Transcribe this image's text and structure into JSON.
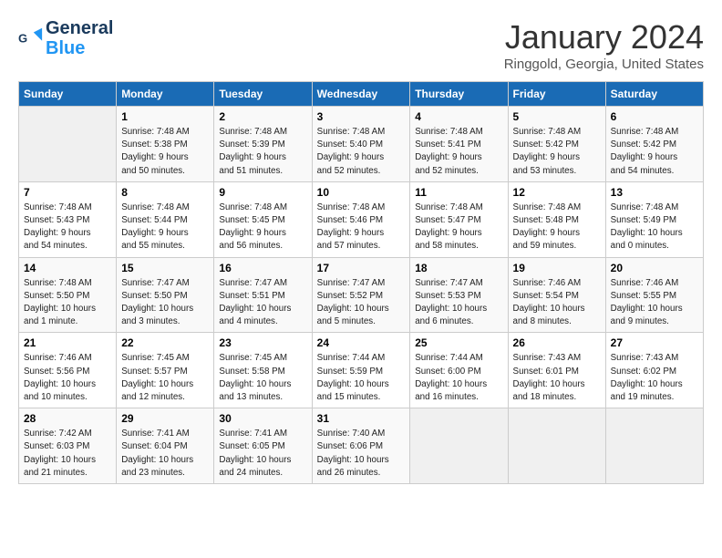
{
  "logo": {
    "text_general": "General",
    "text_blue": "Blue"
  },
  "header": {
    "month": "January 2024",
    "location": "Ringgold, Georgia, United States"
  },
  "days_of_week": [
    "Sunday",
    "Monday",
    "Tuesday",
    "Wednesday",
    "Thursday",
    "Friday",
    "Saturday"
  ],
  "weeks": [
    [
      {
        "day": "",
        "info": ""
      },
      {
        "day": "1",
        "info": "Sunrise: 7:48 AM\nSunset: 5:38 PM\nDaylight: 9 hours\nand 50 minutes."
      },
      {
        "day": "2",
        "info": "Sunrise: 7:48 AM\nSunset: 5:39 PM\nDaylight: 9 hours\nand 51 minutes."
      },
      {
        "day": "3",
        "info": "Sunrise: 7:48 AM\nSunset: 5:40 PM\nDaylight: 9 hours\nand 52 minutes."
      },
      {
        "day": "4",
        "info": "Sunrise: 7:48 AM\nSunset: 5:41 PM\nDaylight: 9 hours\nand 52 minutes."
      },
      {
        "day": "5",
        "info": "Sunrise: 7:48 AM\nSunset: 5:42 PM\nDaylight: 9 hours\nand 53 minutes."
      },
      {
        "day": "6",
        "info": "Sunrise: 7:48 AM\nSunset: 5:42 PM\nDaylight: 9 hours\nand 54 minutes."
      }
    ],
    [
      {
        "day": "7",
        "info": "Sunrise: 7:48 AM\nSunset: 5:43 PM\nDaylight: 9 hours\nand 54 minutes."
      },
      {
        "day": "8",
        "info": "Sunrise: 7:48 AM\nSunset: 5:44 PM\nDaylight: 9 hours\nand 55 minutes."
      },
      {
        "day": "9",
        "info": "Sunrise: 7:48 AM\nSunset: 5:45 PM\nDaylight: 9 hours\nand 56 minutes."
      },
      {
        "day": "10",
        "info": "Sunrise: 7:48 AM\nSunset: 5:46 PM\nDaylight: 9 hours\nand 57 minutes."
      },
      {
        "day": "11",
        "info": "Sunrise: 7:48 AM\nSunset: 5:47 PM\nDaylight: 9 hours\nand 58 minutes."
      },
      {
        "day": "12",
        "info": "Sunrise: 7:48 AM\nSunset: 5:48 PM\nDaylight: 9 hours\nand 59 minutes."
      },
      {
        "day": "13",
        "info": "Sunrise: 7:48 AM\nSunset: 5:49 PM\nDaylight: 10 hours\nand 0 minutes."
      }
    ],
    [
      {
        "day": "14",
        "info": "Sunrise: 7:48 AM\nSunset: 5:50 PM\nDaylight: 10 hours\nand 1 minute."
      },
      {
        "day": "15",
        "info": "Sunrise: 7:47 AM\nSunset: 5:50 PM\nDaylight: 10 hours\nand 3 minutes."
      },
      {
        "day": "16",
        "info": "Sunrise: 7:47 AM\nSunset: 5:51 PM\nDaylight: 10 hours\nand 4 minutes."
      },
      {
        "day": "17",
        "info": "Sunrise: 7:47 AM\nSunset: 5:52 PM\nDaylight: 10 hours\nand 5 minutes."
      },
      {
        "day": "18",
        "info": "Sunrise: 7:47 AM\nSunset: 5:53 PM\nDaylight: 10 hours\nand 6 minutes."
      },
      {
        "day": "19",
        "info": "Sunrise: 7:46 AM\nSunset: 5:54 PM\nDaylight: 10 hours\nand 8 minutes."
      },
      {
        "day": "20",
        "info": "Sunrise: 7:46 AM\nSunset: 5:55 PM\nDaylight: 10 hours\nand 9 minutes."
      }
    ],
    [
      {
        "day": "21",
        "info": "Sunrise: 7:46 AM\nSunset: 5:56 PM\nDaylight: 10 hours\nand 10 minutes."
      },
      {
        "day": "22",
        "info": "Sunrise: 7:45 AM\nSunset: 5:57 PM\nDaylight: 10 hours\nand 12 minutes."
      },
      {
        "day": "23",
        "info": "Sunrise: 7:45 AM\nSunset: 5:58 PM\nDaylight: 10 hours\nand 13 minutes."
      },
      {
        "day": "24",
        "info": "Sunrise: 7:44 AM\nSunset: 5:59 PM\nDaylight: 10 hours\nand 15 minutes."
      },
      {
        "day": "25",
        "info": "Sunrise: 7:44 AM\nSunset: 6:00 PM\nDaylight: 10 hours\nand 16 minutes."
      },
      {
        "day": "26",
        "info": "Sunrise: 7:43 AM\nSunset: 6:01 PM\nDaylight: 10 hours\nand 18 minutes."
      },
      {
        "day": "27",
        "info": "Sunrise: 7:43 AM\nSunset: 6:02 PM\nDaylight: 10 hours\nand 19 minutes."
      }
    ],
    [
      {
        "day": "28",
        "info": "Sunrise: 7:42 AM\nSunset: 6:03 PM\nDaylight: 10 hours\nand 21 minutes."
      },
      {
        "day": "29",
        "info": "Sunrise: 7:41 AM\nSunset: 6:04 PM\nDaylight: 10 hours\nand 23 minutes."
      },
      {
        "day": "30",
        "info": "Sunrise: 7:41 AM\nSunset: 6:05 PM\nDaylight: 10 hours\nand 24 minutes."
      },
      {
        "day": "31",
        "info": "Sunrise: 7:40 AM\nSunset: 6:06 PM\nDaylight: 10 hours\nand 26 minutes."
      },
      {
        "day": "",
        "info": ""
      },
      {
        "day": "",
        "info": ""
      },
      {
        "day": "",
        "info": ""
      }
    ]
  ]
}
